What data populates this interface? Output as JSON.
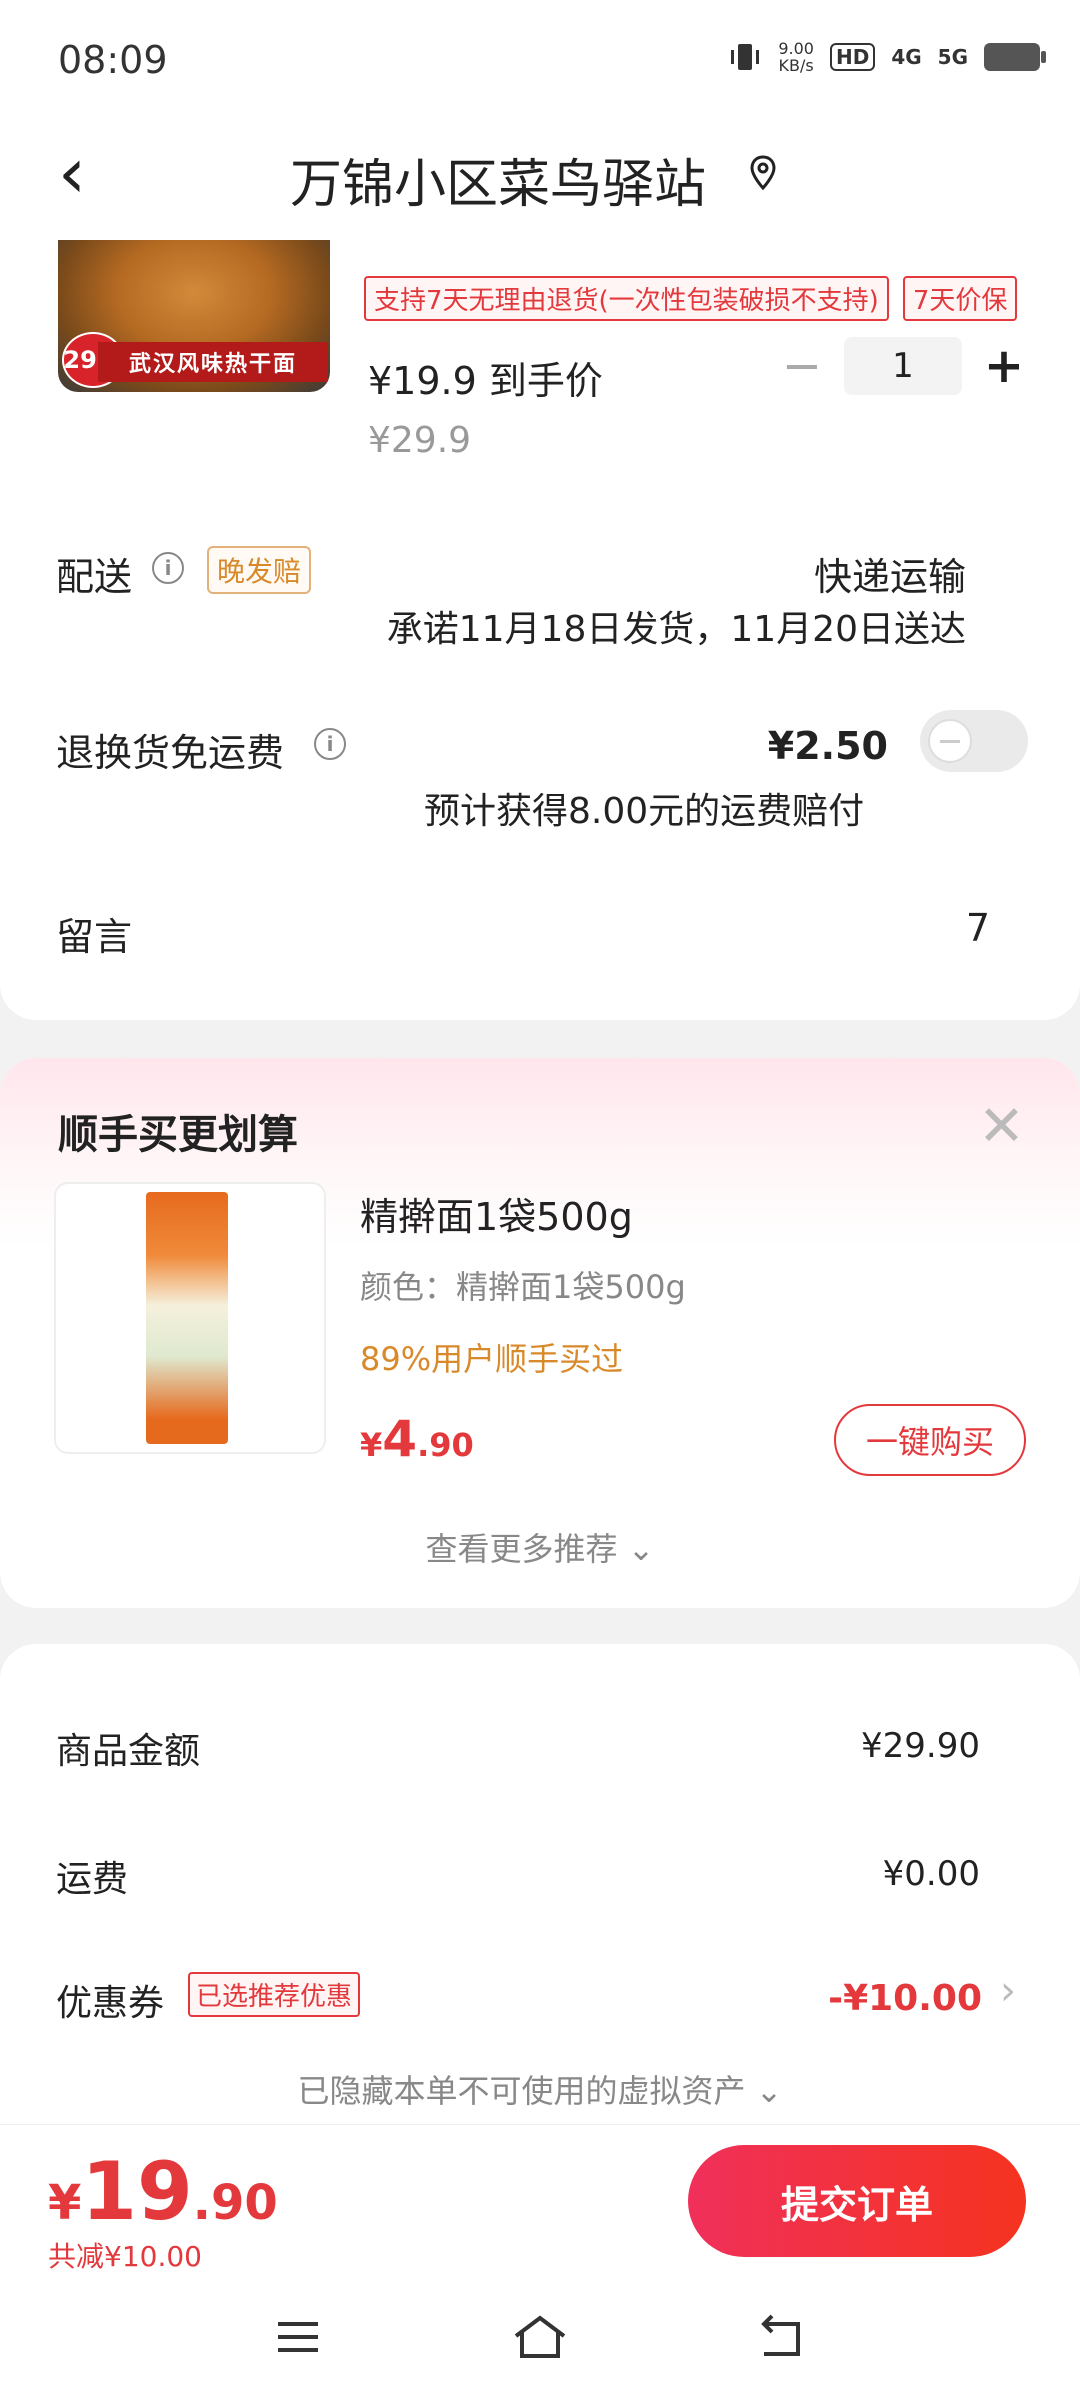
{
  "status_bar": {
    "time": "08:09",
    "speed": "9.00",
    "speed_unit": "KB/s",
    "hd": "HD",
    "net1": "4G",
    "net2": "5G"
  },
  "header": {
    "title": "万锦小区菜鸟驿站"
  },
  "product": {
    "image_banner": "武汉风味热干面",
    "image_price": "29.9",
    "tags": [
      "支持7天无理由退货(一次性包装破损不支持)",
      "7天价保"
    ],
    "deal_price": "¥19.9 到手价",
    "original_price": "¥29.9",
    "quantity": "1"
  },
  "delivery": {
    "label": "配送",
    "badge": "晚发赔",
    "method": "快递运输",
    "promise": "承诺11月18日发货，11月20日送达"
  },
  "return_shipping": {
    "label": "退换货免运费",
    "price": "¥2.50",
    "note": "预计获得8.00元的运费赔付"
  },
  "message": {
    "label": "留言",
    "count": "7"
  },
  "recommend": {
    "title": "顺手买更划算",
    "name": "精擀面1袋500g",
    "color": "颜色：精擀面1袋500g",
    "percent": "89%用户顺手买过",
    "price_symbol": "¥",
    "price_int": "4",
    "price_dec": ".90",
    "buy_label": "一键购买",
    "more_label": "查看更多推荐 ⌄"
  },
  "summary": {
    "goods_label": "商品金额",
    "goods_value": "¥29.90",
    "shipping_label": "运费",
    "shipping_value": "¥0.00",
    "coupon_label": "优惠券",
    "coupon_badge": "已选推荐优惠",
    "coupon_value": "-¥10.00",
    "hidden_assets": "已隐藏本单不可使用的虚拟资产 ⌄"
  },
  "footer": {
    "yen": "¥",
    "total_int": "19",
    "total_dec": ".90",
    "saved": "共减¥10.00",
    "submit_label": "提交订单"
  }
}
